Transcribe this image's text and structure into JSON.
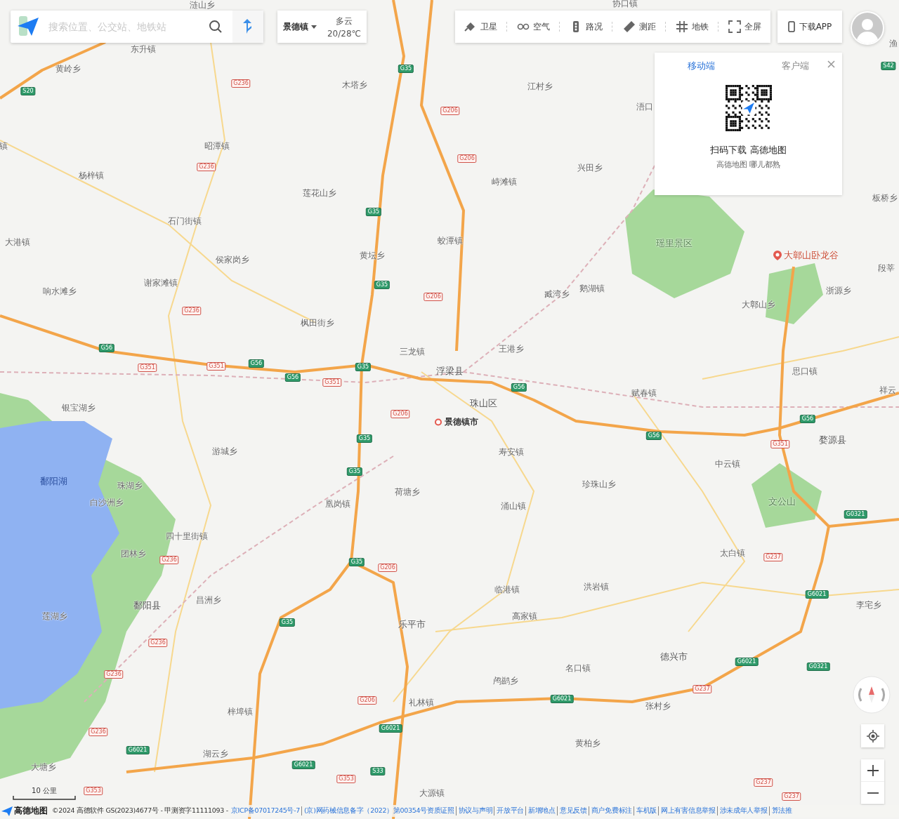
{
  "search": {
    "placeholder": "搜索位置、公交站、地铁站"
  },
  "city_selector": {
    "label": "景德镇"
  },
  "weather": {
    "condition": "多云",
    "temperature": "20/28℃"
  },
  "toolbar": [
    {
      "kind": "satellite",
      "label": "卫星"
    },
    {
      "kind": "air",
      "label": "空气"
    },
    {
      "kind": "traffic",
      "label": "路况"
    },
    {
      "kind": "ruler",
      "label": "测距"
    },
    {
      "kind": "subway",
      "label": "地铁"
    },
    {
      "kind": "fullscreen",
      "label": "全屏"
    }
  ],
  "download_button": {
    "label": "下载APP"
  },
  "app_popup": {
    "tabs": [
      {
        "label": "移动端",
        "selected": true
      },
      {
        "label": "客户端",
        "selected": false
      }
    ],
    "title": "扫码下载 高德地图",
    "subtitle": "高德地图 哪儿都熟"
  },
  "map": {
    "places": [
      {
        "name": "涟山乡",
        "kind": "town"
      },
      {
        "name": "协口镇",
        "kind": "town"
      },
      {
        "name": "东升镇",
        "kind": "town"
      },
      {
        "name": "渔",
        "kind": "town"
      },
      {
        "name": "黄岭乡",
        "kind": "town"
      },
      {
        "name": "木塔乡",
        "kind": "town"
      },
      {
        "name": "江村乡",
        "kind": "town"
      },
      {
        "name": "浯口",
        "kind": "town"
      },
      {
        "name": "镇",
        "kind": "town"
      },
      {
        "name": "昭潭镇",
        "kind": "town"
      },
      {
        "name": "杨梓镇",
        "kind": "town"
      },
      {
        "name": "峙滩镇",
        "kind": "town"
      },
      {
        "name": "兴田乡",
        "kind": "town"
      },
      {
        "name": "莲花山乡",
        "kind": "town"
      },
      {
        "name": "板桥乡",
        "kind": "town"
      },
      {
        "name": "石门街镇",
        "kind": "town"
      },
      {
        "name": "大港镇",
        "kind": "town"
      },
      {
        "name": "蛟潭镇",
        "kind": "town"
      },
      {
        "name": "瑶里景区",
        "kind": "area"
      },
      {
        "name": "侯家岗乡",
        "kind": "town"
      },
      {
        "name": "黄坛乡",
        "kind": "town"
      },
      {
        "name": "大鄣山卧龙谷",
        "kind": "poi"
      },
      {
        "name": "段莘",
        "kind": "town"
      },
      {
        "name": "响水滩乡",
        "kind": "town"
      },
      {
        "name": "谢家滩镇",
        "kind": "town"
      },
      {
        "name": "臧湾乡",
        "kind": "town"
      },
      {
        "name": "鹅湖镇",
        "kind": "town"
      },
      {
        "name": "浙源乡",
        "kind": "town"
      },
      {
        "name": "大鄣山乡",
        "kind": "town"
      },
      {
        "name": "枫田街乡",
        "kind": "town"
      },
      {
        "name": "三龙镇",
        "kind": "town"
      },
      {
        "name": "王港乡",
        "kind": "town"
      },
      {
        "name": "浮梁县",
        "kind": "county"
      },
      {
        "name": "思口镇",
        "kind": "town"
      },
      {
        "name": "赋春镇",
        "kind": "town"
      },
      {
        "name": "祥云",
        "kind": "town"
      },
      {
        "name": "银宝湖乡",
        "kind": "town"
      },
      {
        "name": "珠山区",
        "kind": "county"
      },
      {
        "name": "景德镇市",
        "kind": "city"
      },
      {
        "name": "婺源县",
        "kind": "county"
      },
      {
        "name": "游城乡",
        "kind": "town"
      },
      {
        "name": "寿安镇",
        "kind": "town"
      },
      {
        "name": "中云镇",
        "kind": "town"
      },
      {
        "name": "鄱阳湖",
        "kind": "water"
      },
      {
        "name": "珠湖乡",
        "kind": "town"
      },
      {
        "name": "荷塘乡",
        "kind": "town"
      },
      {
        "name": "珍珠山乡",
        "kind": "town"
      },
      {
        "name": "白沙洲乡",
        "kind": "town"
      },
      {
        "name": "凰岗镇",
        "kind": "town"
      },
      {
        "name": "涌山镇",
        "kind": "town"
      },
      {
        "name": "文公山",
        "kind": "area"
      },
      {
        "name": "四十里街镇",
        "kind": "town"
      },
      {
        "name": "团林乡",
        "kind": "town"
      },
      {
        "name": "太白镇",
        "kind": "town"
      },
      {
        "name": "临港镇",
        "kind": "town"
      },
      {
        "name": "洪岩镇",
        "kind": "town"
      },
      {
        "name": "鄱阳县",
        "kind": "county"
      },
      {
        "name": "昌洲乡",
        "kind": "town"
      },
      {
        "name": "李宅乡",
        "kind": "town"
      },
      {
        "name": "莲湖乡",
        "kind": "town"
      },
      {
        "name": "乐平市",
        "kind": "county"
      },
      {
        "name": "高家镇",
        "kind": "town"
      },
      {
        "name": "德兴市",
        "kind": "county"
      },
      {
        "name": "名口镇",
        "kind": "town"
      },
      {
        "name": "鸬鹚乡",
        "kind": "town"
      },
      {
        "name": "梓埠镇",
        "kind": "town"
      },
      {
        "name": "礼林镇",
        "kind": "town"
      },
      {
        "name": "张村乡",
        "kind": "town"
      },
      {
        "name": "黄柏乡",
        "kind": "town"
      },
      {
        "name": "湖云乡",
        "kind": "town"
      },
      {
        "name": "大塘乡",
        "kind": "town"
      },
      {
        "name": "大源镇",
        "kind": "town"
      }
    ],
    "road_shields": [
      {
        "label": "S20",
        "kind": "expressway"
      },
      {
        "label": "G35",
        "kind": "expressway"
      },
      {
        "label": "G35",
        "kind": "expressway"
      },
      {
        "label": "G35",
        "kind": "expressway"
      },
      {
        "label": "G56",
        "kind": "expressway"
      },
      {
        "label": "G56",
        "kind": "expressway"
      },
      {
        "label": "G56",
        "kind": "expressway"
      },
      {
        "label": "G35",
        "kind": "expressway"
      },
      {
        "label": "G56",
        "kind": "expressway"
      },
      {
        "label": "G56",
        "kind": "expressway"
      },
      {
        "label": "G56",
        "kind": "expressway"
      },
      {
        "label": "G35",
        "kind": "expressway"
      },
      {
        "label": "G35",
        "kind": "expressway"
      },
      {
        "label": "G35",
        "kind": "expressway"
      },
      {
        "label": "G35",
        "kind": "expressway"
      },
      {
        "label": "G6021",
        "kind": "expressway"
      },
      {
        "label": "G6021",
        "kind": "expressway"
      },
      {
        "label": "G6021",
        "kind": "expressway"
      },
      {
        "label": "G6021",
        "kind": "expressway"
      },
      {
        "label": "G6021",
        "kind": "expressway"
      },
      {
        "label": "S33",
        "kind": "expressway"
      },
      {
        "label": "G6021",
        "kind": "expressway"
      },
      {
        "label": "G0321",
        "kind": "expressway"
      },
      {
        "label": "G0321",
        "kind": "expressway"
      },
      {
        "label": "S42",
        "kind": "expressway"
      },
      {
        "label": "G236",
        "kind": "national"
      },
      {
        "label": "G206",
        "kind": "national"
      },
      {
        "label": "G206",
        "kind": "national"
      },
      {
        "label": "G236",
        "kind": "national"
      },
      {
        "label": "G206",
        "kind": "national"
      },
      {
        "label": "G236",
        "kind": "national"
      },
      {
        "label": "G351",
        "kind": "national"
      },
      {
        "label": "G351",
        "kind": "national"
      },
      {
        "label": "G351",
        "kind": "national"
      },
      {
        "label": "G206",
        "kind": "national"
      },
      {
        "label": "G351",
        "kind": "national"
      },
      {
        "label": "G236",
        "kind": "national"
      },
      {
        "label": "G206",
        "kind": "national"
      },
      {
        "label": "G236",
        "kind": "national"
      },
      {
        "label": "G236",
        "kind": "national"
      },
      {
        "label": "G206",
        "kind": "national"
      },
      {
        "label": "G237",
        "kind": "national"
      },
      {
        "label": "G237",
        "kind": "national"
      },
      {
        "label": "G236",
        "kind": "national"
      },
      {
        "label": "G353",
        "kind": "national"
      },
      {
        "label": "G237",
        "kind": "national"
      },
      {
        "label": "G237",
        "kind": "national"
      },
      {
        "label": "G353",
        "kind": "national"
      }
    ]
  },
  "scale": {
    "label": "10 公里"
  },
  "footer": {
    "brand": "高德地图",
    "copyright": "©2024 高德软件 GS(2023)4677号 - 甲测资字11111093 -",
    "links": [
      "京ICP备07017245号-7",
      "(京)网药械信息备字（2022）第00354号资质证照",
      "协议与声明",
      "开放平台",
      "新增地点",
      "意见反馈",
      "商户免费标注",
      "车机版",
      "网上有害信息举报",
      "涉未成年人举报",
      "算法推"
    ]
  }
}
